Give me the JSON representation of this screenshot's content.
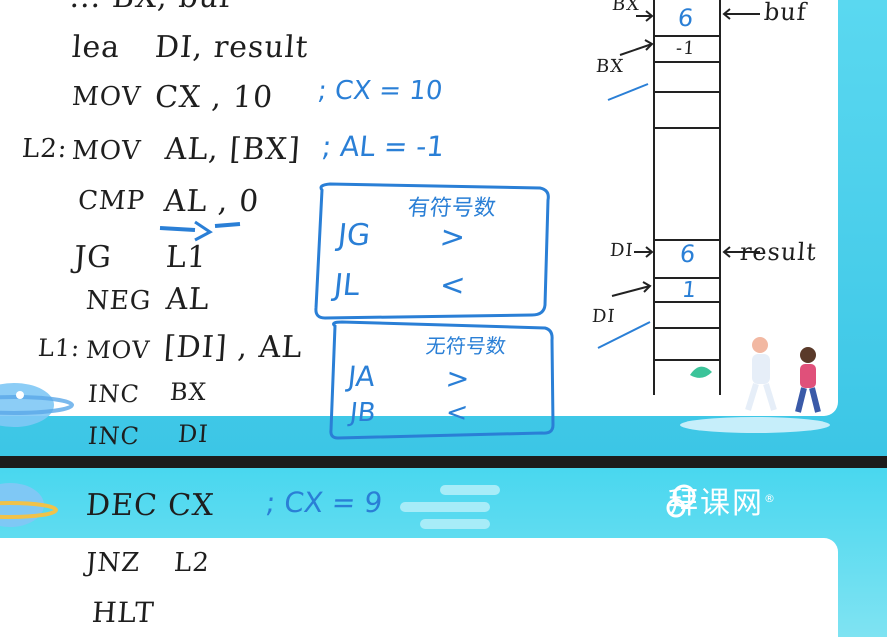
{
  "code": {
    "line0": "... BX, buf",
    "lea_op": "lea",
    "lea_args": "DI, result",
    "mov1_op": "MOV",
    "mov1_args": "CX , 10",
    "mov1_comment": "; CX = 10",
    "l2_label": "L2:",
    "l2_op": "MOV",
    "l2_args": "AL, [BX]",
    "l2_comment": "; AL = -1",
    "cmp_op": "CMP",
    "cmp_args": "AL , 0",
    "jg_op": "JG",
    "jg_args": "L1",
    "neg_op": "NEG",
    "neg_args": "AL",
    "l1_label": "L1:",
    "l1_op": "MOV",
    "l1_args": "[DI] , AL",
    "inc1_op": "INC",
    "inc1_args": "BX",
    "inc2_op": "INC",
    "inc2_args": "DI",
    "dec_op": "DEC",
    "dec_args": "CX",
    "dec_comment": "; CX = 9",
    "jnz_op": "JNZ",
    "jnz_args": "L2",
    "hlt_op": "HLT"
  },
  "signed_box": {
    "title": "有符号数",
    "row1_instr": "JG",
    "row1_sym": ">",
    "row2_instr": "JL",
    "row2_sym": "<"
  },
  "unsigned_box": {
    "title": "无符号数",
    "row1_instr": "JA",
    "row1_sym": ">",
    "row2_instr": "JB",
    "row2_sym": "<"
  },
  "memory": {
    "bx_top": "BX",
    "bx_mid": "BX",
    "buf_label": "buf",
    "buf_val0": "6",
    "buf_val1": "-1",
    "di_top": "DI",
    "di_mid": "DI",
    "result_label": "result",
    "res_val0": "6",
    "res_val1": "1"
  },
  "brand": {
    "name": "拜课网",
    "mark": "®"
  },
  "colors": {
    "ink": "#1e1e1e",
    "pen_blue": "#2a7fd6",
    "frame": "#4fd0ea"
  }
}
